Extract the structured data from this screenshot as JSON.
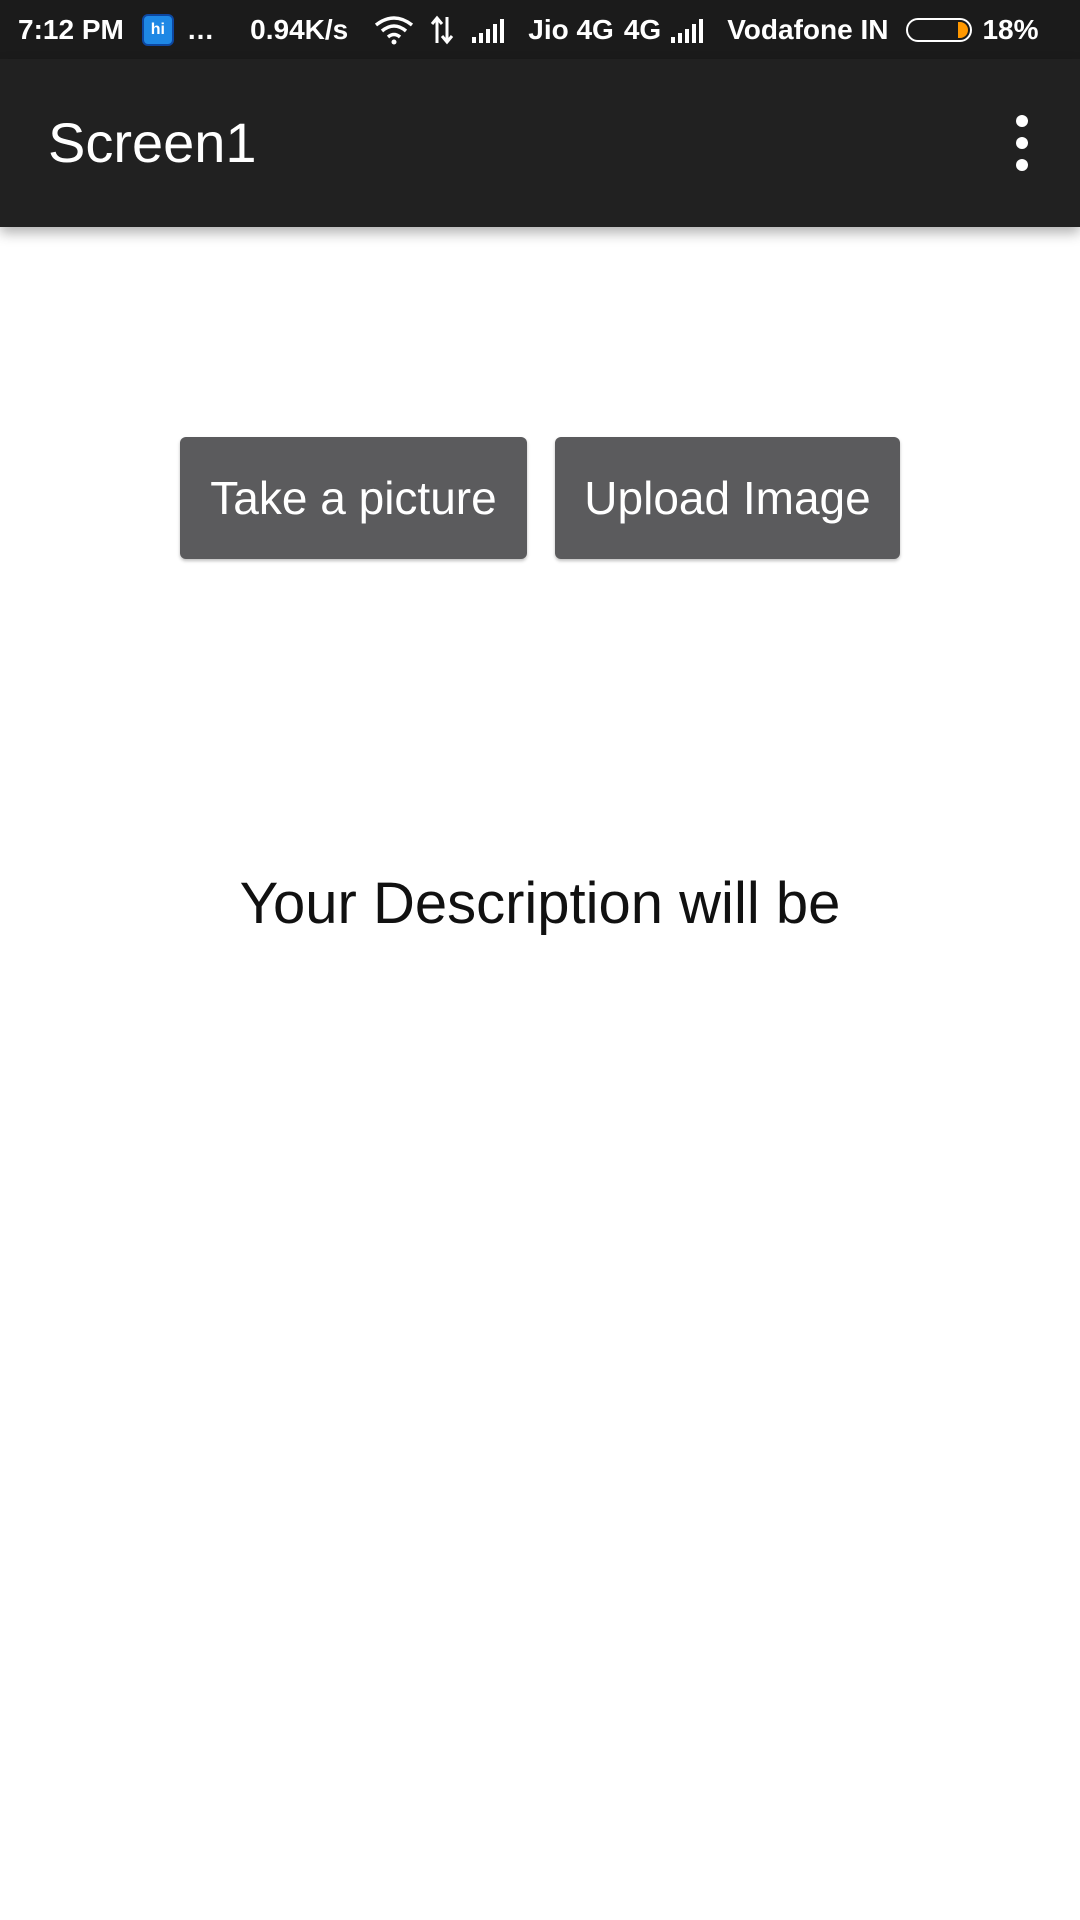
{
  "status_bar": {
    "time": "7:12 PM",
    "app_badge": "hi",
    "more": "...",
    "network_speed": "0.94K/s",
    "carrier1": "Jio 4G",
    "network_type": "4G",
    "carrier2": "Vodafone IN",
    "battery_percent": "18%",
    "battery_level": 0.18,
    "battery_color": "#ff9800"
  },
  "app_bar": {
    "title": "Screen1",
    "menu_icon": "more-vert-icon"
  },
  "main": {
    "take_picture_label": "Take a picture",
    "upload_image_label": "Upload Image",
    "description_text": "Your Description will be"
  }
}
